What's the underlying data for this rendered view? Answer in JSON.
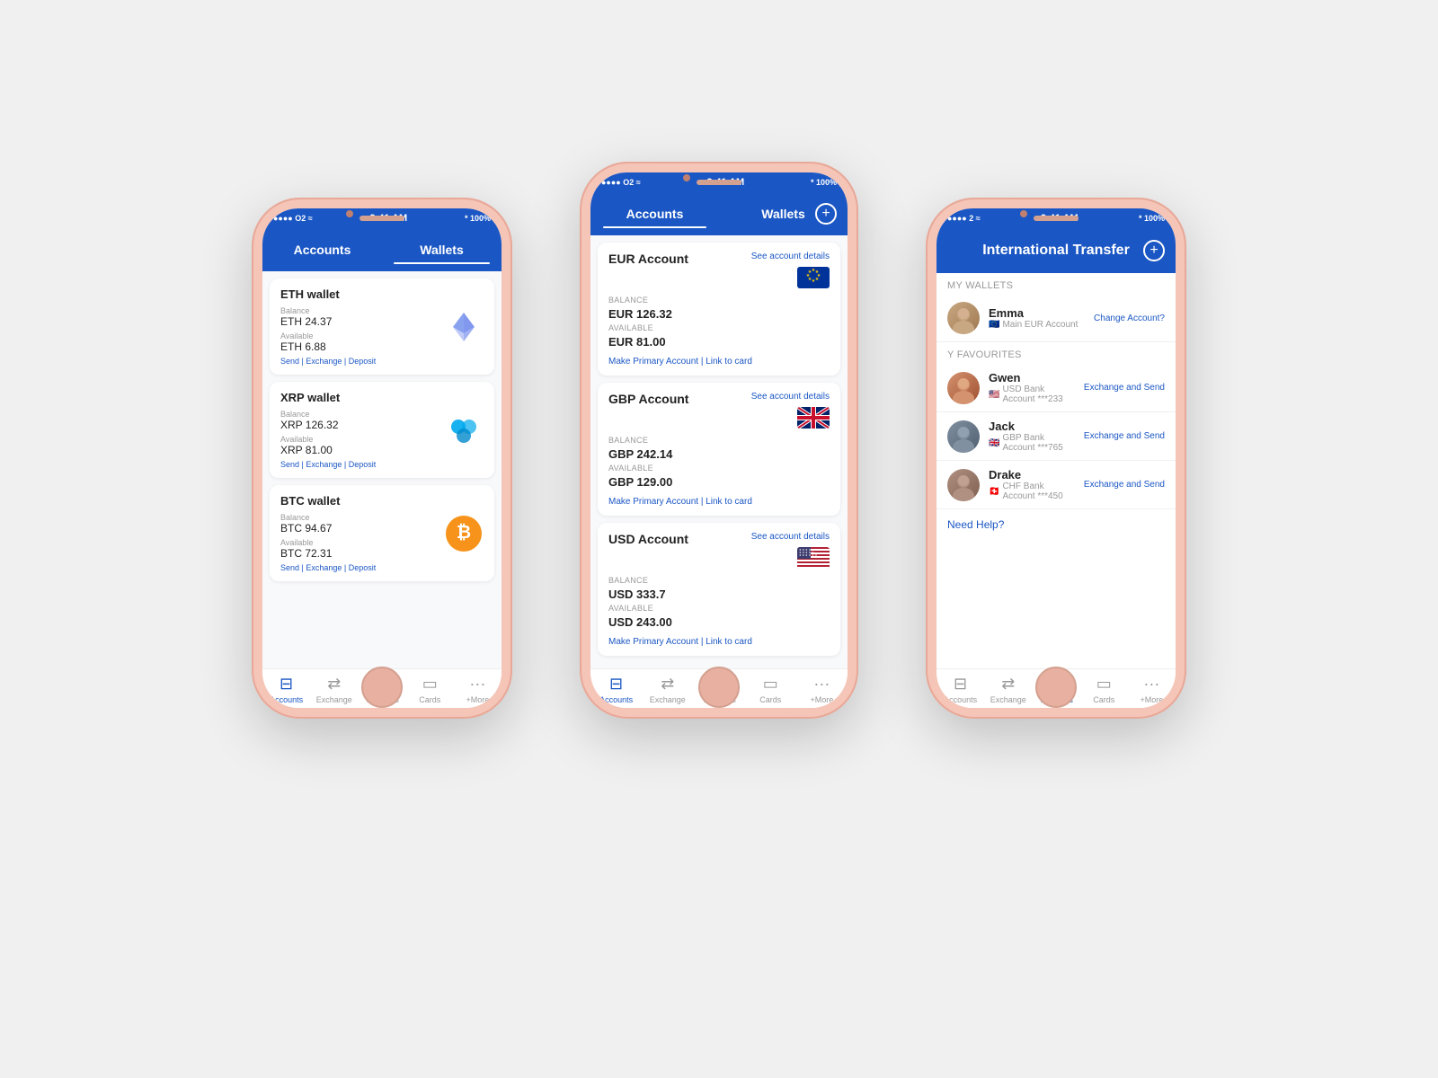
{
  "background": "#f0f0f0",
  "phones": {
    "left": {
      "status": {
        "signal": "●●●● O2 ≈",
        "time": "9:41 AM",
        "battery": "* 100%"
      },
      "nav": {
        "tab1": "Accounts",
        "tab2": "Wallets",
        "activeTab": "Wallets"
      },
      "wallets": [
        {
          "name": "ETH wallet",
          "balanceLabel": "Balance",
          "balanceValue": "ETH 24.37",
          "availableLabel": "Available",
          "availableValue": "ETH 6.88",
          "actions": "Send | Exchange | Deposit",
          "icon": "eth"
        },
        {
          "name": "XRP wallet",
          "balanceLabel": "Balance",
          "balanceValue": "XRP 126.32",
          "availableLabel": "Available",
          "availableValue": "XRP 81.00",
          "actions": "Send | Exchange | Deposit",
          "icon": "xrp"
        },
        {
          "name": "BTC wallet",
          "balanceLabel": "Balance",
          "balanceValue": "BTC 94.67",
          "availableLabel": "Available",
          "availableValue": "BTC 72.31",
          "actions": "Send | Exchange | Deposit",
          "icon": "btc"
        }
      ],
      "bottomNav": [
        {
          "label": "Accounts",
          "icon": "🏦",
          "active": true
        },
        {
          "label": "Exchange",
          "icon": "⇄",
          "active": false
        },
        {
          "label": "Transfers",
          "icon": "👤",
          "active": false
        },
        {
          "label": "Cards",
          "icon": "💳",
          "active": false
        },
        {
          "label": "+More",
          "icon": "···",
          "active": false
        }
      ]
    },
    "center": {
      "status": {
        "signal": "●●●● O2 ≈",
        "time": "9:41 AM",
        "battery": "* 100%"
      },
      "nav": {
        "tab1": "Accounts",
        "tab2": "Wallets",
        "activeTab": "Accounts"
      },
      "accounts": [
        {
          "name": "EUR Account",
          "detailLink": "See account details",
          "flag": "eu",
          "balanceLabel": "Balance",
          "balanceValue": "EUR 126.32",
          "availableLabel": "Available",
          "availableValue": "EUR 81.00",
          "actions": "Make Primary Account | Link to card"
        },
        {
          "name": "GBP Account",
          "detailLink": "See account details",
          "flag": "gb",
          "balanceLabel": "Balance",
          "balanceValue": "GBP 242.14",
          "availableLabel": "Available",
          "availableValue": "GBP 129.00",
          "actions": "Make Primary Account | Link to card"
        },
        {
          "name": "USD Account",
          "detailLink": "See account details",
          "flag": "us",
          "balanceLabel": "Balance",
          "balanceValue": "USD 333.7",
          "availableLabel": "Available",
          "availableValue": "USD 243.00",
          "actions": "Make Primary Account | Link to card"
        }
      ],
      "bottomNav": [
        {
          "label": "Accounts",
          "icon": "🏦",
          "active": true
        },
        {
          "label": "Exchange",
          "icon": "⇄",
          "active": false
        },
        {
          "label": "Transfers",
          "icon": "👤",
          "active": false
        },
        {
          "label": "Cards",
          "icon": "💳",
          "active": false
        },
        {
          "label": "+More",
          "icon": "···",
          "active": false
        }
      ]
    },
    "right": {
      "status": {
        "signal": "●●●● 2 ≈",
        "time": "9:41 AM",
        "battery": "* 100%"
      },
      "title": "International Transfer",
      "sectionMyWallets": "My Wallets",
      "currentUser": {
        "name": "Emma",
        "account": "Main EUR Account",
        "flag": "🇪🇺",
        "changeLabel": "Change Account?"
      },
      "sectionFavourites": "y Favourites",
      "favourites": [
        {
          "name": "Gwen",
          "account": "USD Bank Account ***233",
          "flag": "🇺🇸",
          "action": "Exchange and Send",
          "avatar": "gwen"
        },
        {
          "name": "Jack",
          "account": "GBP Bank Account ***765",
          "flag": "🇬🇧",
          "action": "Exchange and Send",
          "avatar": "jack"
        },
        {
          "name": "Drake",
          "account": "CHF Bank Account ***450",
          "flag": "🇨🇭",
          "action": "Exchange and Send",
          "avatar": "drake"
        }
      ],
      "helpText": "Need Help?",
      "bottomNav": [
        {
          "label": "Accounts",
          "icon": "🏦",
          "active": false
        },
        {
          "label": "Exchange",
          "icon": "⇄",
          "active": false
        },
        {
          "label": "Transfers",
          "icon": "👤",
          "active": true
        },
        {
          "label": "Cards",
          "icon": "💳",
          "active": false
        },
        {
          "label": "+More",
          "icon": "···",
          "active": false
        }
      ]
    }
  }
}
